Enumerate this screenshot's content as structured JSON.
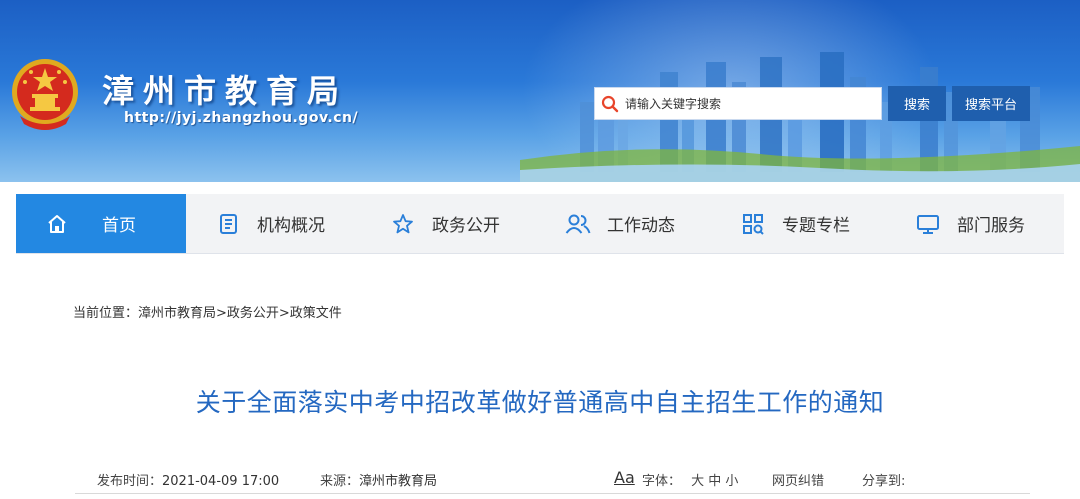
{
  "header": {
    "site_title": "漳州市教育局",
    "site_url": "http://jyj.zhangzhou.gov.cn/",
    "search_placeholder": "请输入关键字搜索",
    "search_button": "搜索",
    "search_platform_button": "搜索平台",
    "emblem_icon": "national-emblem-icon"
  },
  "nav": {
    "items": [
      {
        "label": "首页",
        "icon": "home-icon",
        "active": true
      },
      {
        "label": "机构概况",
        "icon": "document-list-icon",
        "active": false
      },
      {
        "label": "政务公开",
        "icon": "star-icon",
        "active": false
      },
      {
        "label": "工作动态",
        "icon": "users-icon",
        "active": false
      },
      {
        "label": "专题专栏",
        "icon": "grid-search-icon",
        "active": false
      },
      {
        "label": "部门服务",
        "icon": "monitor-icon",
        "active": false
      }
    ]
  },
  "breadcrumb": {
    "text": "当前位置：漳州市教育局>政务公开>政策文件"
  },
  "article": {
    "title": "关于全面落实中考中招改革做好普通高中自主招生工作的通知",
    "publish_label": "发布时间：",
    "publish_time": "2021-04-09 17:00",
    "source_label": "来源：",
    "source_value": "漳州市教育局",
    "font_icon_text": "Aa",
    "font_label": "字体：",
    "font_sizes": "大 中 小",
    "correction_label": "网页纠错",
    "share_label": "分享到:"
  },
  "colors": {
    "banner_blue": "#2a79d8",
    "nav_active": "#2388e2",
    "title_blue": "#2468c1",
    "button_blue": "#1f5fae"
  }
}
